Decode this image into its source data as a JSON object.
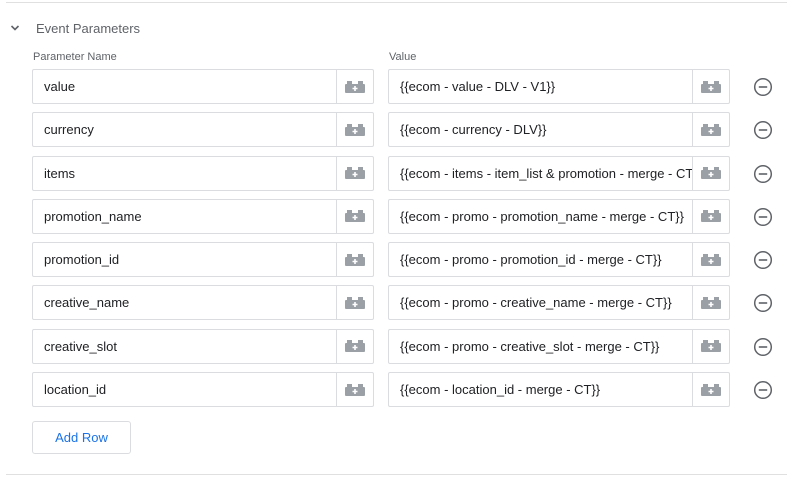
{
  "section": {
    "title": "Event Parameters",
    "toggle_icon": "chevron-down-icon"
  },
  "columns": {
    "name": "Parameter Name",
    "value": "Value"
  },
  "rows": [
    {
      "name": "value",
      "value": "{{ecom - value - DLV - V1}}"
    },
    {
      "name": "currency",
      "value": "{{ecom - currency - DLV}}"
    },
    {
      "name": "items",
      "value": "{{ecom - items - item_list & promotion - merge - CT"
    },
    {
      "name": "promotion_name",
      "value": "{{ecom - promo - promotion_name - merge - CT}}"
    },
    {
      "name": "promotion_id",
      "value": "{{ecom - promo - promotion_id - merge - CT}}"
    },
    {
      "name": "creative_name",
      "value": "{{ecom - promo - creative_name - merge - CT}}"
    },
    {
      "name": "creative_slot",
      "value": "{{ecom - promo - creative_slot - merge - CT}}"
    },
    {
      "name": "location_id",
      "value": "{{ecom - location_id - merge - CT}}"
    }
  ],
  "add_row_label": "Add Row",
  "icons": {
    "variable": "variable-picker-icon",
    "remove": "remove-circle-icon"
  },
  "colors": {
    "accent": "#1a73e8",
    "border": "#dadce0",
    "icon_gray": "#9aa0a6",
    "label_gray": "#5f6368"
  }
}
